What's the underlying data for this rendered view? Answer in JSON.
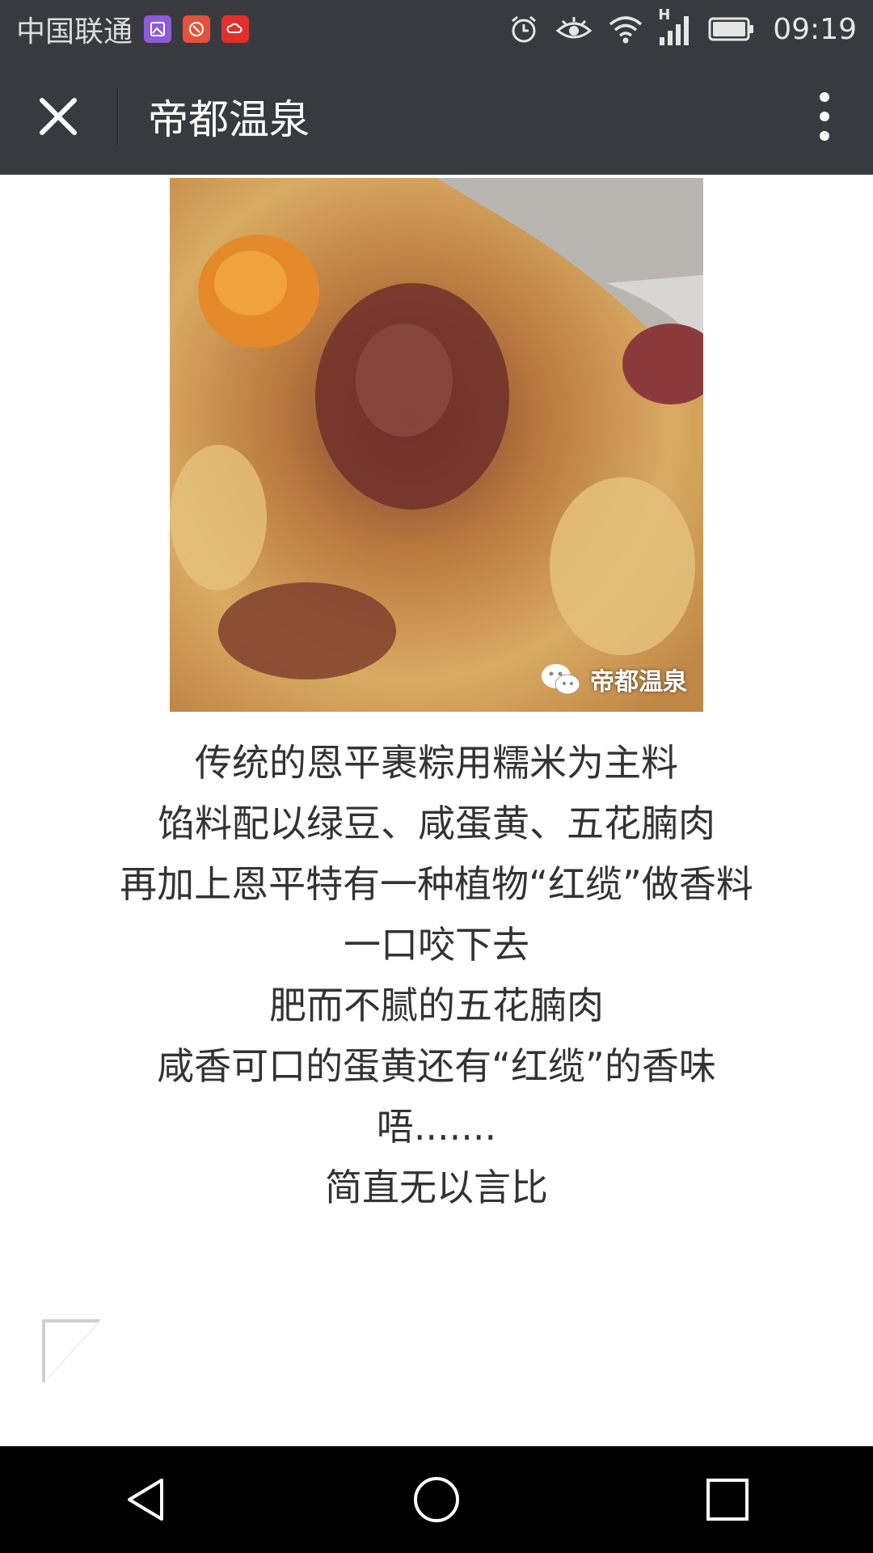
{
  "status_bar": {
    "carrier": "中国联通",
    "network": "H",
    "time": "09:19",
    "notification_icons": [
      "gallery-app-icon",
      "tools-app-icon",
      "cloud-app-icon"
    ]
  },
  "title_bar": {
    "title": "帝都温泉"
  },
  "article": {
    "image_watermark": "帝都温泉",
    "lines": [
      "传统的恩平裹粽用糯米为主料",
      "馅料配以绿豆、咸蛋黄、五花腩肉",
      "再加上恩平特有一种植物“红缆”做香料",
      "一口咬下去",
      "肥而不腻的五花腩肉",
      "咸香可口的蛋黄还有“红缆”的香味",
      "唔.......",
      "简直无以言比"
    ]
  },
  "colors": {
    "bar_bg": "#393a3f",
    "text": "#333333",
    "nav_bg": "#000000"
  }
}
